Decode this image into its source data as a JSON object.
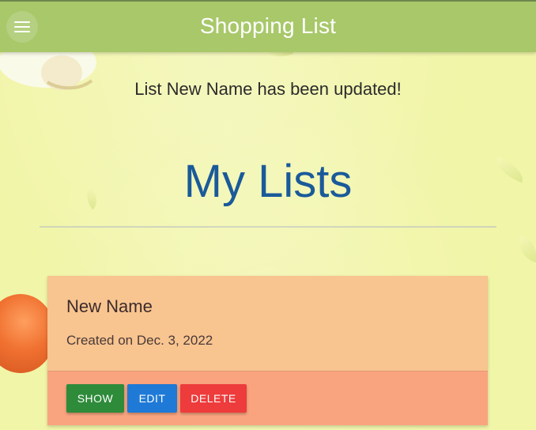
{
  "app": {
    "title": "Shopping List"
  },
  "flash": {
    "message": "List New Name has been updated!"
  },
  "page": {
    "title": "My Lists"
  },
  "lists": [
    {
      "name": "New Name",
      "created": "Created on Dec. 3, 2022",
      "actions": {
        "show": "SHOW",
        "edit": "EDIT",
        "delete": "DELETE"
      }
    }
  ],
  "colors": {
    "appbar": "#a8c86a",
    "page_title": "#1a5a9a",
    "card_bg": "#f8c48f",
    "card_actions_bg": "#f9a47f",
    "show_button": "#2e8b3a",
    "edit_button": "#1e7ad6",
    "delete_button": "#ee3b3b"
  },
  "icons": {
    "menu": "menu-icon"
  }
}
